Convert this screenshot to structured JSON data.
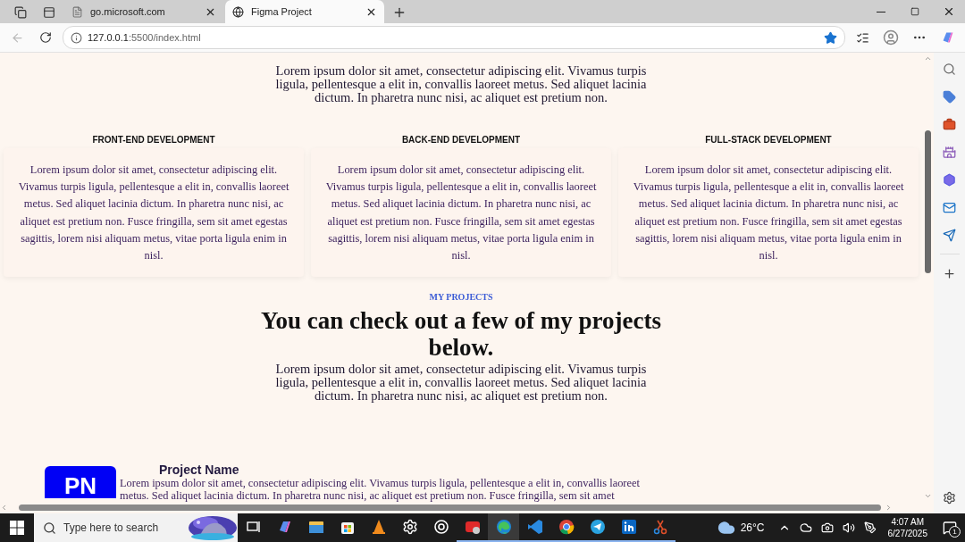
{
  "browser": {
    "tabs": [
      {
        "title": "go.microsoft.com",
        "selected": false
      },
      {
        "title": "Figma Project",
        "selected": true
      }
    ],
    "address_host": "127.0.0.1",
    "address_path": ":5500/index.html",
    "favorite": true
  },
  "page": {
    "intro": "Lorem ipsum dolor sit amet, consectetur adipiscing elit. Vivamus turpis ligula, pellentesque a elit in, convallis laoreet metus. Sed aliquet lacinia dictum. In pharetra nunc nisi, ac aliquet est pretium non.",
    "services": [
      {
        "title": "FRONT-END DEVELOPMENT",
        "text": "Lorem ipsum dolor sit amet, consectetur adipiscing elit. Vivamus turpis ligula, pellentesque a elit in, convallis laoreet metus. Sed aliquet lacinia dictum. In pharetra nunc nisi, ac aliquet est pretium non. Fusce fringilla, sem sit amet egestas sagittis, lorem nisi aliquam metus, vitae porta ligula enim in nisl."
      },
      {
        "title": "BACK-END DEVELOPMENT",
        "text": "Lorem ipsum dolor sit amet, consectetur adipiscing elit. Vivamus turpis ligula, pellentesque a elit in, convallis laoreet metus. Sed aliquet lacinia dictum. In pharetra nunc nisi, ac aliquet est pretium non. Fusce fringilla, sem sit amet egestas sagittis, lorem nisi aliquam metus, vitae porta ligula enim in nisl."
      },
      {
        "title": "FULL-STACK DEVELOPMENT",
        "text": "Lorem ipsum dolor sit amet, consectetur adipiscing elit. Vivamus turpis ligula, pellentesque a elit in, convallis laoreet metus. Sed aliquet lacinia dictum. In pharetra nunc nisi, ac aliquet est pretium non. Fusce fringilla, sem sit amet egestas sagittis, lorem nisi aliquam metus, vitae porta ligula enim in nisl."
      }
    ],
    "projects_eyebrow": "MY PROJECTS",
    "projects_heading": "You can check out a few of my projects below.",
    "projects_intro": "Lorem ipsum dolor sit amet, consectetur adipiscing elit. Vivamus turpis ligula, pellentesque a elit in, convallis laoreet metus. Sed aliquet lacinia dictum. In pharetra nunc nisi, ac aliquet est pretium non.",
    "project": {
      "logo": "PN",
      "name": "Project Name",
      "text": "Lorem ipsum dolor sit amet, consectetur adipiscing elit. Vivamus turpis ligula, pellentesque a elit in, convallis laoreet metus. Sed aliquet lacinia dictum. In pharetra nunc nisi, ac aliquet est pretium non. Fusce fringilla, sem sit amet"
    }
  },
  "taskbar": {
    "search_placeholder": "Type here to search",
    "apps": [
      {
        "kind": "copilot",
        "selected": false,
        "running": false
      },
      {
        "kind": "explorer",
        "selected": false,
        "running": false
      },
      {
        "kind": "store",
        "selected": false,
        "running": false
      },
      {
        "kind": "vlc",
        "selected": false,
        "running": false
      },
      {
        "kind": "settings",
        "selected": false,
        "running": false
      },
      {
        "kind": "chatgpt",
        "selected": false,
        "running": false
      },
      {
        "kind": "app",
        "selected": false,
        "running": true
      },
      {
        "kind": "edge",
        "selected": true,
        "running": true
      },
      {
        "kind": "vscode",
        "selected": false,
        "running": true
      },
      {
        "kind": "chrome",
        "selected": false,
        "running": true
      },
      {
        "kind": "telegram",
        "selected": false,
        "running": true
      },
      {
        "kind": "linkedin",
        "selected": false,
        "running": true
      },
      {
        "kind": "snip",
        "selected": false,
        "running": true
      }
    ],
    "weather": "26°C",
    "time": "4:07 AM",
    "date": "6/27/2025",
    "notifications": "1"
  }
}
